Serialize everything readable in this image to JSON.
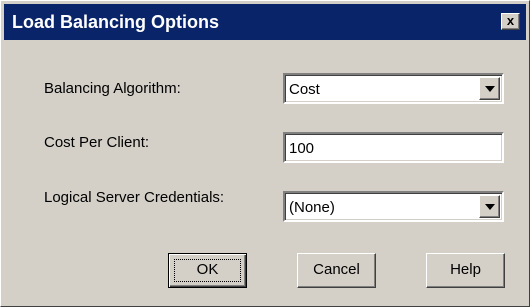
{
  "window": {
    "title": "Load Balancing Options",
    "close_glyph": "x"
  },
  "form": {
    "algorithm": {
      "label": "Balancing Algorithm:",
      "value": "Cost"
    },
    "cost": {
      "label": "Cost Per Client:",
      "value": "100"
    },
    "credentials": {
      "label": "Logical Server Credentials:",
      "value": "(None)"
    }
  },
  "buttons": {
    "ok": "OK",
    "cancel": "Cancel",
    "help": "Help"
  },
  "colors": {
    "titlebar": "#0a246a",
    "face": "#d4d0c8"
  }
}
